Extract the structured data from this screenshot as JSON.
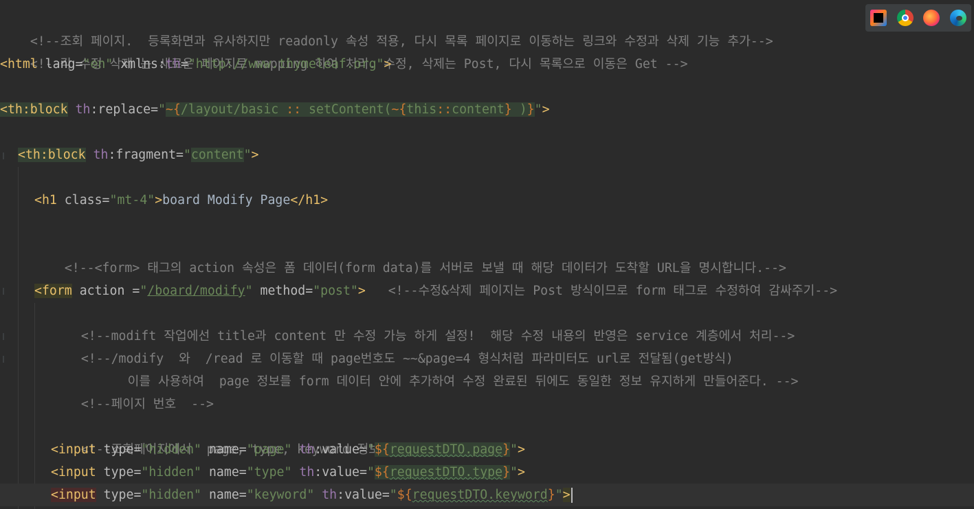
{
  "toolbar": {
    "icons": [
      "intellij-icon",
      "chrome-icon",
      "firefox-icon",
      "edge-icon"
    ]
  },
  "code": {
    "line1": "<!--조회 페이지.  등록화면과 유사하지만 readonly 속성 적용, 다시 목록 페이지로 이동하는 링크와 수정과 삭제 기능 추가-->",
    "line2": "<!--각 수정 삭제 는 새로운 페이지로 mapping 하여 처리. 수정, 삭제는 Post, 다시 목록으로 이동은 Get -->",
    "line3": {
      "open": "<html",
      "lang_attr": " lang=",
      "lang_val": "\"en\"",
      "xmlns_attr": " xmlns:",
      "xmlns_ns": "th",
      "eq": "=",
      "xmlns_val": "\"http://www.thymeleaf.org\"",
      "close": ">"
    },
    "line4": {
      "open": "<th:block",
      "attr_ns": "th",
      "attr": ":replace=",
      "q1": "\"",
      "ex1": "~{",
      "path": "/layout/basic ",
      "sep": "::",
      "fn": " setContent(",
      "ex2": "~{",
      "this": "this",
      "sep2": "::",
      "content": "content",
      "ex3": "}",
      "paren": " )",
      "ex4": "}",
      "q2": "\"",
      "close": ">"
    },
    "line5": {
      "open": "<th:block",
      "attr_ns": "th",
      "attr": ":fragment=",
      "q1": "\"",
      "val": "content",
      "q2": "\"",
      "close": ">"
    },
    "line6": {
      "open": "<h1",
      "attr": " class=",
      "val": "\"mt-4\"",
      "close": ">",
      "text": "board Modify Page",
      "end": "</h1>"
    },
    "line7": "<!--<form> 태그의 action 속성은 폼 데이터(form data)를 서버로 보낼 때 해당 데이터가 도착할 URL을 명시합니다.-->",
    "line8": {
      "open": "<form",
      "attr1": " action =",
      "q1": "\"",
      "val1": "/board/modify",
      "q2": "\"",
      "attr2": " method=",
      "val2": "\"post\"",
      "close": ">",
      "comment": "   <!--수정&삭제 페이지는 Post 방식이므로 form 태그로 수정하여 감싸주기-->"
    },
    "line9": "<!--modift 작업에선 title과 content 만 수정 가능 하게 설정!  해당 수정 내용의 반영은 service 계층에서 처리-->",
    "line10": "<!--/modify  와  /read 로 이동할 때 page번호도 ~~&page=4 형식처럼 파라미터도 url로 전달됨(get방식)",
    "line11": "    이를 사용하여  page 정보를 form 데이터 안에 추가하여 수정 완료된 뒤에도 동일한 정보 유지하게 만들어준다. -->",
    "line12": "<!--페이지 번호  -->",
    "line13": "<!--조회페이지에서  page, type, keyword 정보 처리. -->",
    "line14": {
      "open": "<input",
      "attr1": " type=",
      "val1": "\"hidden\"",
      "attr2": " name=",
      "val2": "\"page\"",
      "ns": " th",
      "attr3": ":value=",
      "q1": "\"",
      "ex1": "${",
      "expr": "requestDTO.page",
      "ex2": "}",
      "q2": "\"",
      "close": ">"
    },
    "line15": {
      "open": "<input",
      "attr1": " type=",
      "val1": "\"hidden\"",
      "attr2": " name=",
      "val2": "\"type\"",
      "ns": " th",
      "attr3": ":value=",
      "q1": "\"",
      "ex1": "${",
      "expr": "requestDTO.type",
      "ex2": "}",
      "q2": "\"",
      "close": ">"
    },
    "line16": {
      "lt": "<",
      "open": "input",
      "attr1": " type=",
      "val1": "\"hidden\"",
      "attr2": " name=",
      "val2": "\"keyword\"",
      "ns": " th",
      "attr3": ":value=",
      "q1": "\"",
      "ex1": "${",
      "expr": "requestDTO.keyword",
      "ex2": "}",
      "q2": "\"",
      "close": ">"
    }
  }
}
